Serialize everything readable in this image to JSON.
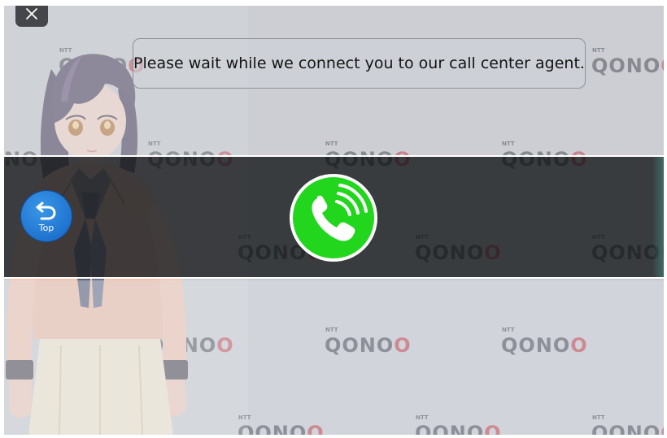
{
  "message": {
    "text": "Please wait while we connect you to our call center agent."
  },
  "top_button": {
    "label": "Top",
    "icon": "return-arrow-icon"
  },
  "close_button": {
    "icon": "close-icon"
  },
  "call_button": {
    "icon": "phone-ringing-icon",
    "color": "#22d61e"
  },
  "watermark": {
    "brand": "QONOQ",
    "small_text": "NTT"
  },
  "colors": {
    "middle_band": "#222426",
    "accent_blue": "#1f7fdc",
    "call_green": "#22d61e"
  }
}
